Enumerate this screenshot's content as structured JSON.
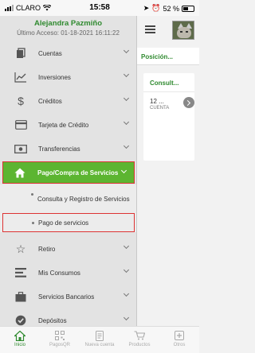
{
  "status_bar": {
    "carrier": "CLARO",
    "time": "15:58",
    "battery": "52 %"
  },
  "user": {
    "name": "Alejandra Pazmiño",
    "last_access": "Último Acceso: 01-18-2021 16:11:22"
  },
  "menu": [
    {
      "label": "Cuentas",
      "icon": "wallet-icon"
    },
    {
      "label": "Inversiones",
      "icon": "line-chart-icon"
    },
    {
      "label": "Créditos",
      "icon": "dollar-icon"
    },
    {
      "label": "Tarjeta de Crédito",
      "icon": "credit-card-icon"
    },
    {
      "label": "Transferencias",
      "icon": "cash-icon"
    },
    {
      "label": "Pago/Compra de Servicios",
      "icon": "home-icon"
    },
    {
      "label": "Retiro",
      "icon": "star-icon"
    },
    {
      "label": "Mis Consumos",
      "icon": "bars-icon"
    },
    {
      "label": "Servicios Bancarios",
      "icon": "briefcase-icon"
    },
    {
      "label": "Depósitos",
      "icon": "check-circle-icon"
    }
  ],
  "submenu": [
    {
      "label": "Consulta y Registro de Servicios"
    },
    {
      "label": "Pago de servicios"
    }
  ],
  "content": {
    "section_title": "Posición...",
    "card_title": "Consult...",
    "card_value": "12 ...",
    "card_sub": "CUENTA"
  },
  "tabs": [
    {
      "label": "Inicio",
      "icon": "home-icon",
      "active": true
    },
    {
      "label": "PagosQR",
      "icon": "qr-code-icon",
      "active": false
    },
    {
      "label": "Nueva cuenta",
      "icon": "document-icon",
      "active": false
    },
    {
      "label": "Productos",
      "icon": "cart-icon",
      "active": false
    },
    {
      "label": "Otros",
      "icon": "plus-square-icon",
      "active": false
    }
  ],
  "colors": {
    "brand_green": "#5cb531",
    "highlight_red": "#d33333"
  }
}
